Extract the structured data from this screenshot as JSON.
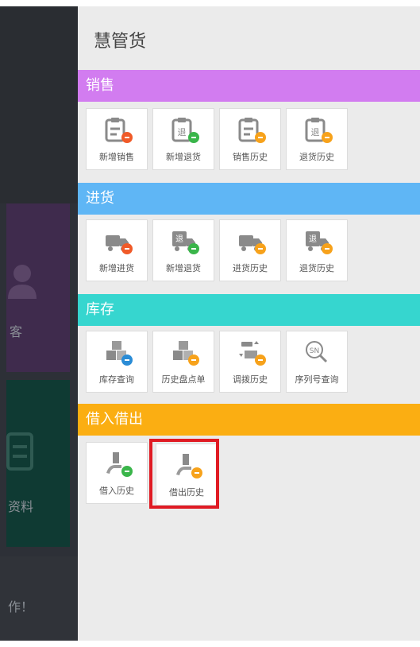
{
  "app_title": "慧管货",
  "background": {
    "card1_label": "客",
    "card2_label": "资料",
    "bottom_label": "作！"
  },
  "sections": [
    {
      "title": "销售",
      "color": "#d27cf0",
      "items": [
        {
          "label": "新增销售",
          "icon": "clipboard-add-icon",
          "badge": "#f05a28"
        },
        {
          "label": "新增退货",
          "icon": "clipboard-return-add-icon",
          "badge": "#3ab54a"
        },
        {
          "label": "销售历史",
          "icon": "clipboard-history-icon",
          "badge": "#f7a21b"
        },
        {
          "label": "退货历史",
          "icon": "clipboard-return-history-icon",
          "badge": "#f7a21b"
        }
      ]
    },
    {
      "title": "进货",
      "color": "#5fb6f5",
      "items": [
        {
          "label": "新增进货",
          "icon": "truck-add-icon",
          "badge": "#f05a28"
        },
        {
          "label": "新增退货",
          "icon": "truck-return-add-icon",
          "badge": "#3ab54a"
        },
        {
          "label": "进货历史",
          "icon": "truck-history-icon",
          "badge": "#f7a21b"
        },
        {
          "label": "退货历史",
          "icon": "truck-return-history-icon",
          "badge": "#f7a21b"
        }
      ]
    },
    {
      "title": "库存",
      "color": "#36d6cf",
      "items": [
        {
          "label": "库存查询",
          "icon": "boxes-search-icon",
          "badge": "#2a8cd6"
        },
        {
          "label": "历史盘点单",
          "icon": "boxes-history-icon",
          "badge": "#f7a21b"
        },
        {
          "label": "调拨历史",
          "icon": "transfer-history-icon",
          "badge": "#f7a21b"
        },
        {
          "label": "序列号查询",
          "icon": "sn-search-icon",
          "badge": ""
        }
      ]
    },
    {
      "title": "借入借出",
      "color": "#fbae12",
      "items": [
        {
          "label": "借入历史",
          "icon": "borrow-in-icon",
          "badge": "#3ab54a"
        },
        {
          "label": "借出历史",
          "icon": "lend-out-icon",
          "badge": "#f7a21b"
        }
      ]
    }
  ],
  "highlight_color": "#e01b24"
}
